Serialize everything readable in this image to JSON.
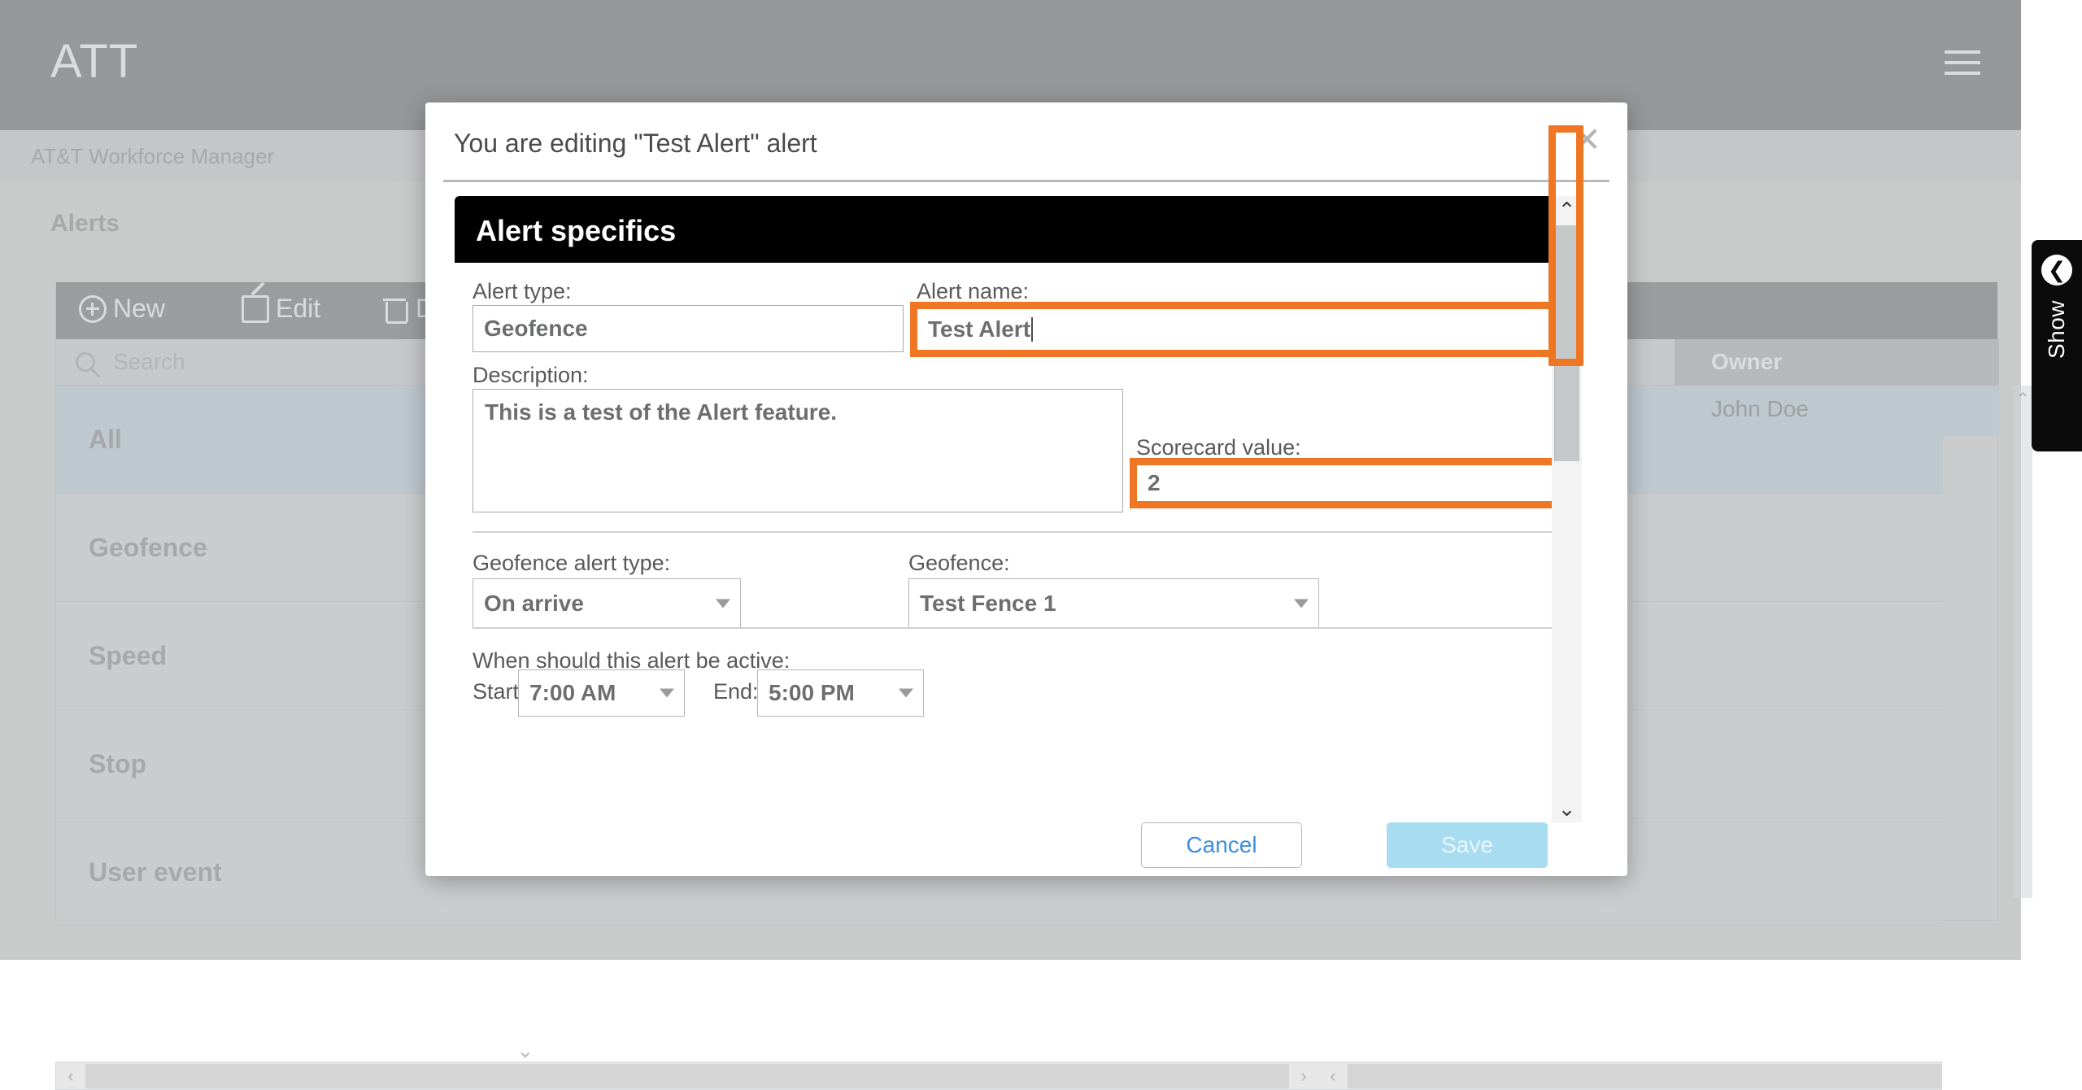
{
  "app": {
    "brand": "ATT",
    "subtitle": "AT&T Workforce Manager",
    "page_title": "Alerts",
    "menu_icon": "hamburger-icon"
  },
  "toolbar": {
    "new_label": "New",
    "edit_label": "Edit",
    "delete_label": "Dele"
  },
  "search": {
    "placeholder": "Search",
    "icon": "search-icon"
  },
  "nav": {
    "items": [
      {
        "label": "All",
        "active": true
      },
      {
        "label": "Geofence",
        "active": false
      },
      {
        "label": "Speed",
        "active": false
      },
      {
        "label": "Stop",
        "active": false
      },
      {
        "label": "User event",
        "active": false
      }
    ]
  },
  "table": {
    "columns": [
      "Owner"
    ],
    "rows": [
      [
        "John Doe"
      ]
    ]
  },
  "side_tab": {
    "label": "Show",
    "icon": "arrow-left-circle-icon"
  },
  "modal": {
    "title": "You are editing \"Test Alert\" alert",
    "close_icon": "close-icon",
    "section_title": "Alert specifics",
    "fields": {
      "alert_type_label": "Alert type:",
      "alert_type_value": "Geofence",
      "alert_name_label": "Alert name:",
      "alert_name_value": "Test Alert",
      "description_label": "Description:",
      "description_value": "This is a test of the Alert feature.",
      "scorecard_label": "Scorecard value:",
      "scorecard_value": "2",
      "geofence_alert_type_label": "Geofence alert type:",
      "geofence_alert_type_value": "On arrive",
      "geofence_label": "Geofence:",
      "geofence_value": "Test Fence 1",
      "active_label": "When should this alert be active:",
      "start_label": "Start:",
      "start_value": "7:00 AM",
      "end_label": "End:",
      "end_value": "5:00 PM"
    },
    "buttons": {
      "cancel": "Cancel",
      "save": "Save"
    },
    "scrollbar": {
      "up_icon": "chevron-up-icon",
      "down_icon": "chevron-down-icon"
    }
  },
  "highlights": {
    "color": "#ef7622",
    "targets": [
      "alert-name-input",
      "scorecard-value-input",
      "modal-scrollbar-thumb"
    ]
  },
  "scrollbars": {
    "bottom_left_arrow": "‹",
    "bottom_right_arrow": "›",
    "bottom_second_left_arrow": "‹",
    "list_up_arrow": "⌃",
    "list_down_arrow": "⌄"
  }
}
